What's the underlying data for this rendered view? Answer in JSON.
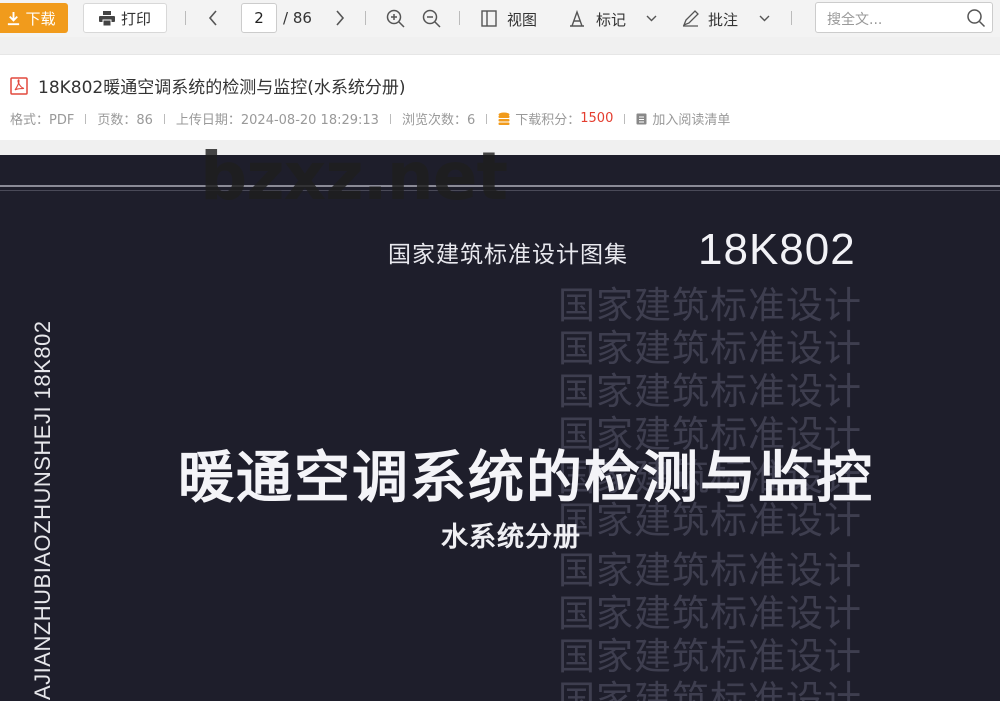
{
  "toolbar": {
    "download_label": "下载",
    "print_label": "打印",
    "current_page": "2",
    "total_pages": "/ 86",
    "view_label": "视图",
    "mark_label": "标记",
    "annotate_label": "批注",
    "search_placeholder": "搜全文..."
  },
  "document": {
    "title": "18K802暖通空调系统的检测与监控(水系统分册)",
    "meta": {
      "format": "格式：PDF",
      "pages": "页数：86",
      "upload_date": "上传日期：2024-08-20 18:29:13",
      "views": "浏览次数：6",
      "points_label": "下载积分：",
      "points_value": "1500",
      "add_reading_list": "加入阅读清单"
    }
  },
  "viewer": {
    "watermark": "bzxz.net",
    "series": "国家建筑标准设计图集",
    "code": "18K802",
    "background_text": "国家建筑标准设计",
    "main_title": "暖通空调系统的检测与监控",
    "sub_title": "水系统分册",
    "spine": "AJIANZHUBIAOZHUNSHEJI   18K802"
  },
  "colors": {
    "download_button": "#f19b1c",
    "points_value": "#e43d2f",
    "cover_background": "#1e1e2b"
  }
}
